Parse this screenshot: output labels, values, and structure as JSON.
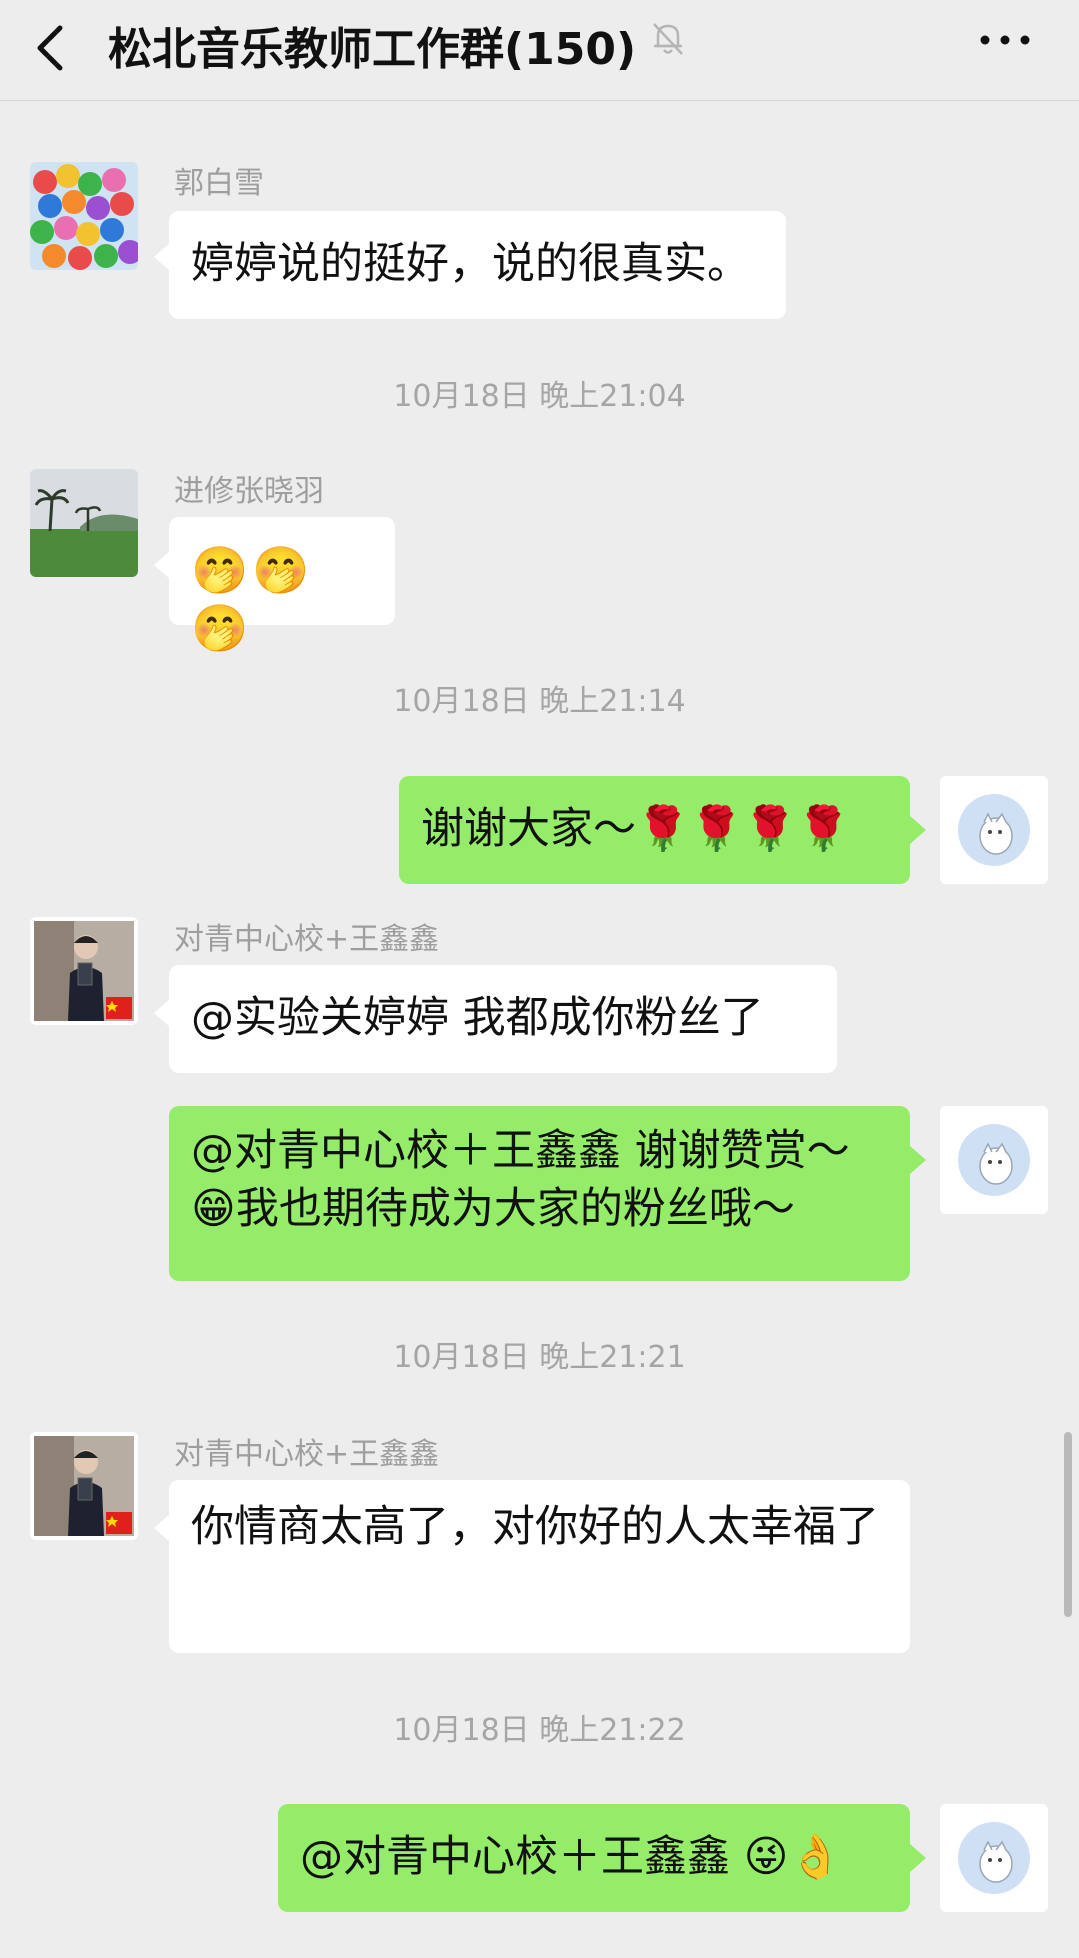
{
  "header": {
    "title": "松北音乐教师工作群(150)",
    "back_icon": "back-chevron-icon",
    "mute_icon": "bell-muted-icon",
    "more_icon": "more-dots-icon"
  },
  "messages": [
    {
      "sender": "郭白雪",
      "text": "婷婷说的挺好，说的很真实。"
    },
    {
      "timestamp": "10月18日 晚上21:04"
    },
    {
      "sender": "进修张晓羽",
      "text": "🤭🤭🤭"
    },
    {
      "timestamp": "10月18日 晚上21:14"
    },
    {
      "self": true,
      "text": "谢谢大家～🌹🌹🌹🌹"
    },
    {
      "sender": "对青中心校+王鑫鑫",
      "text": "@实验关婷婷  我都成你粉丝了"
    },
    {
      "self": true,
      "text": "@对青中心校＋王鑫鑫  谢谢赞赏～😁我也期待成为大家的粉丝哦～"
    },
    {
      "timestamp": "10月18日 晚上21:21"
    },
    {
      "sender": "对青中心校+王鑫鑫",
      "text": "你情商太高了，对你好的人太幸福了"
    },
    {
      "timestamp": "10月18日 晚上21:22"
    },
    {
      "self": true,
      "text": "@对青中心校＋王鑫鑫  😜👌"
    }
  ],
  "colors": {
    "background": "#ededed",
    "incoming_bubble": "#ffffff",
    "outgoing_bubble": "#95ec69",
    "timestamp_text": "#a5a5a5",
    "sender_text": "#9e9e9e"
  }
}
